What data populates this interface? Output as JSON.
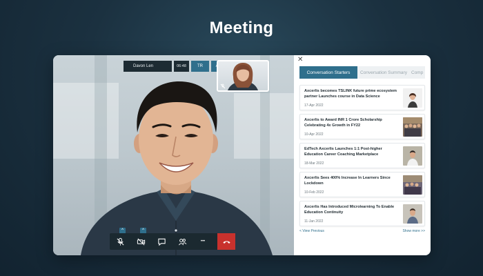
{
  "page_title": "Meeting",
  "call": {
    "participant_name": "Davon Len",
    "elapsed": "06:48",
    "language_buttons": [
      "TR",
      "AUD"
    ],
    "controls": [
      {
        "name": "mic-muted",
        "icon": "mic-off-icon",
        "has_caret": true
      },
      {
        "name": "camera-off",
        "icon": "video-off-icon",
        "has_caret": true
      },
      {
        "name": "chat",
        "icon": "chat-icon",
        "has_caret": false
      },
      {
        "name": "participants",
        "icon": "participants-icon",
        "has_caret": false
      },
      {
        "name": "more",
        "icon": "more-icon",
        "has_caret": false
      },
      {
        "name": "end-call",
        "icon": "phone-hangup-icon",
        "has_caret": false
      }
    ],
    "caret_glyph": "^",
    "more_glyph": "•••"
  },
  "panel": {
    "close_glyph": "✕",
    "tabs": [
      {
        "label": "Conversation Starters",
        "active": true
      },
      {
        "label": "Conversation Summary",
        "active": false
      },
      {
        "label": "Comp",
        "active": false
      }
    ],
    "articles": [
      {
        "title": "Axcerlis becomes TSLINK future prime ecosystem partner Launches course in Data Science",
        "date": "17-Apr 2022",
        "thumb": "portrait"
      },
      {
        "title": "Axcerlis to Award INR 1 Crore Scholarship Celebrating 4x Growth in FY22",
        "date": "10-Apr 2022",
        "thumb": "group"
      },
      {
        "title": "EdTech Axcerlis Launches 1:1 Post-higher Education Career Coaching Marketplace",
        "date": "18-Mar 2022",
        "thumb": "man"
      },
      {
        "title": "Axcerlis Sees 400% Increase In Learners Since Lockdown",
        "date": "10-Feb 2022",
        "thumb": "group"
      },
      {
        "title": "Axcerlis Has Introduced Microlearning To Enable Education Continuity",
        "date": "11-Jan 2022",
        "thumb": "man"
      }
    ],
    "view_previous": "< View Previous",
    "show_more": "Show more >>"
  },
  "colors": {
    "accent": "#2f6f8c",
    "end_call": "#c8312d",
    "toolbar": "#1b2930",
    "background": "#1b3140"
  }
}
